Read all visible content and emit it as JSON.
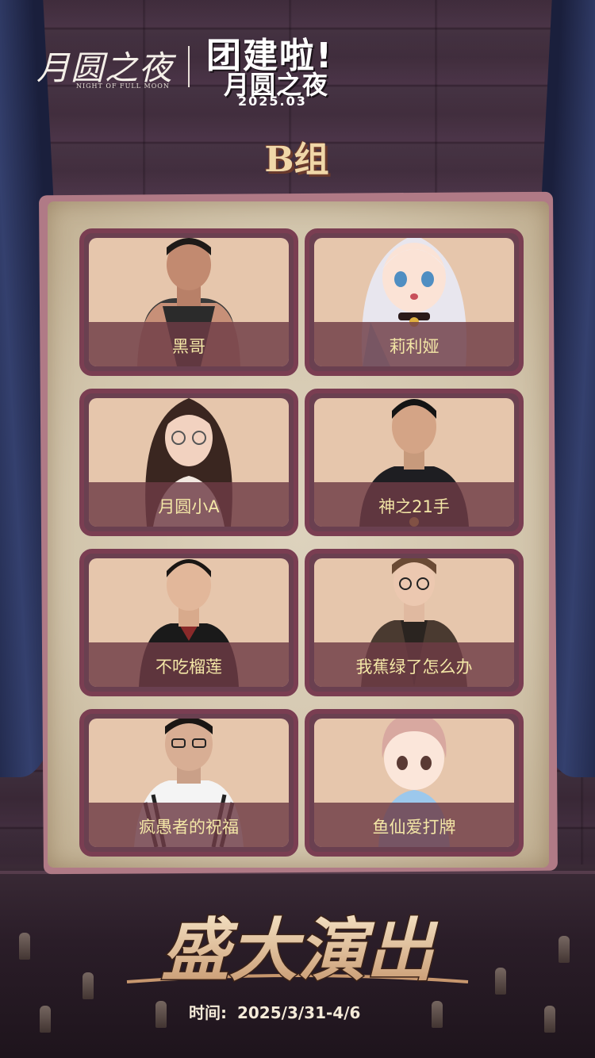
{
  "header": {
    "logo_text": "月圆之夜",
    "logo_subtitle": "NIGHT OF FULL MOON",
    "headline": "团建啦!",
    "headline_sub": "月圆之夜",
    "headline_date": "2025.03"
  },
  "group_title": "B组",
  "members": [
    {
      "name": "黑哥",
      "avatar": "photo-man-tanktop"
    },
    {
      "name": "莉利娅",
      "avatar": "anime-girl-silver-hair"
    },
    {
      "name": "月圆小A",
      "avatar": "photo-woman-glasses"
    },
    {
      "name": "神之21手",
      "avatar": "photo-man-polo"
    },
    {
      "name": "不吃榴莲",
      "avatar": "photo-boy-black-shirt"
    },
    {
      "name": "我蕉绿了怎么办",
      "avatar": "photo-man-glasses-coat"
    },
    {
      "name": "疯愚者的祝福",
      "avatar": "photo-man-glasses-track-jacket"
    },
    {
      "name": "鱼仙爱打牌",
      "avatar": "chibi-boy-pink-hair"
    }
  ],
  "footer": {
    "banner": "盛大演出",
    "time_label": "时间:",
    "time_value": "2025/3/31-4/6"
  },
  "colors": {
    "name_text": "#f3e6a6",
    "card_frame": "#7a3e52",
    "card_bg": "#e6c6ac",
    "group_title": "#f0d7a8"
  }
}
